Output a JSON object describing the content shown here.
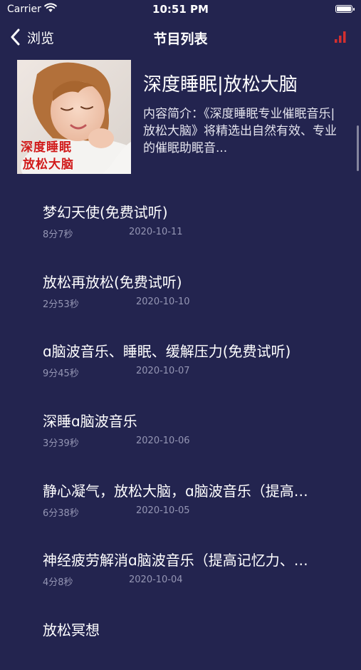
{
  "status_bar": {
    "carrier": "Carrier",
    "time": "10:51 PM"
  },
  "nav": {
    "back_label": "浏览",
    "title": "节目列表",
    "accent_color": "#d32f2f"
  },
  "album": {
    "cover_text_line1": "深度睡眠",
    "cover_text_line2": "放松大脑",
    "title": "深度睡眠|放松大脑",
    "description": "内容简介：《深度睡眠专业催眠音乐|放松大脑》将精选出自然有效、专业的催眠助眠音..."
  },
  "tracks": [
    {
      "title": "梦幻天使(免费试听)",
      "duration": "8分7秒",
      "date": "2020-10-11"
    },
    {
      "title": "放松再放松(免费试听)",
      "duration": "2分53秒",
      "date": "2020-10-10"
    },
    {
      "title": "ɑ脑波音乐、睡眠、缓解压力(免费试听)",
      "duration": "9分45秒",
      "date": "2020-10-07"
    },
    {
      "title": "深睡ɑ脑波音乐",
      "duration": "3分39秒",
      "date": "2020-10-06"
    },
    {
      "title": "静心凝气，放松大脑，ɑ脑波音乐（提高…",
      "duration": "6分38秒",
      "date": "2020-10-05"
    },
    {
      "title": "神经疲劳解消ɑ脑波音乐（提高记忆力、…",
      "duration": "4分8秒",
      "date": "2020-10-04"
    },
    {
      "title": "放松冥想",
      "duration": "",
      "date": ""
    }
  ]
}
